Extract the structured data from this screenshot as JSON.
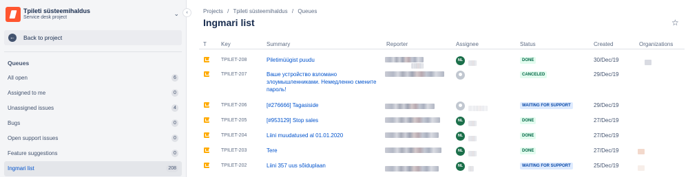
{
  "project": {
    "name": "Tpileti süsteemihaldus",
    "type": "Service desk project"
  },
  "sidebar": {
    "back_label": "Back to project",
    "queues_title": "Queues",
    "items": [
      {
        "label": "All open",
        "count": "6"
      },
      {
        "label": "Assigned to me",
        "count": "0"
      },
      {
        "label": "Unassigned issues",
        "count": "4"
      },
      {
        "label": "Bugs",
        "count": "0"
      },
      {
        "label": "Open support issues",
        "count": "0"
      },
      {
        "label": "Feature suggestions",
        "count": "0"
      },
      {
        "label": "Ingmari list",
        "count": "208"
      }
    ]
  },
  "breadcrumb": [
    "Projects",
    "/",
    "Tpileti süsteemihaldus",
    "/",
    "Queues"
  ],
  "page_title": "Ingmari list",
  "columns": {
    "t": "T",
    "key": "Key",
    "summary": "Summary",
    "reporter": "Reporter",
    "assignee": "Assignee",
    "status": "Status",
    "created": "Created",
    "organizations": "Organizations"
  },
  "rows": [
    {
      "key": "TPILET-208",
      "summary": "Piletimüügist puudu",
      "assignee": "NL",
      "status": "DONE",
      "created": "30/Dec/19"
    },
    {
      "key": "TPILET-207",
      "summary": "Ваше устройство взломано злоумышленниками. Немедленно смените пароль!",
      "assignee": "",
      "status": "CANCELED",
      "created": "29/Dec/19"
    },
    {
      "key": "TPILET-206",
      "summary": "[#276666] Tagasiside",
      "assignee": "",
      "status": "WAITING FOR SUPPORT",
      "created": "29/Dec/19"
    },
    {
      "key": "TPILET-205",
      "summary": "[#953129] Stop sales",
      "assignee": "NL",
      "status": "DONE",
      "created": "27/Dec/19"
    },
    {
      "key": "TPILET-204",
      "summary": "Liini muudatused al 01.01.2020",
      "assignee": "NL",
      "status": "DONE",
      "created": "27/Dec/19"
    },
    {
      "key": "TPILET-203",
      "summary": "Tere",
      "assignee": "NL",
      "status": "DONE",
      "created": "27/Dec/19"
    },
    {
      "key": "TPILET-202",
      "summary": "Liini 357 uus sõiduplaan",
      "assignee": "NL",
      "status": "WAITING FOR SUPPORT",
      "created": "25/Dec/19"
    }
  ],
  "colors": {
    "accent": "#0052cc",
    "logo": "#ff5630",
    "type_icon": "#ffab00",
    "avatar": "#1b6f4a",
    "status_done_bg": "#e3fcef",
    "status_waiting_bg": "#deebff"
  },
  "icons": {
    "project_logo": "project-logo-icon",
    "chevron": "chevron-down-icon",
    "back": "arrow-left-icon",
    "collapse": "chevron-left-icon",
    "star": "star-icon",
    "issue_type": "service-request-icon",
    "avatar_empty": "unassigned-user-icon"
  }
}
